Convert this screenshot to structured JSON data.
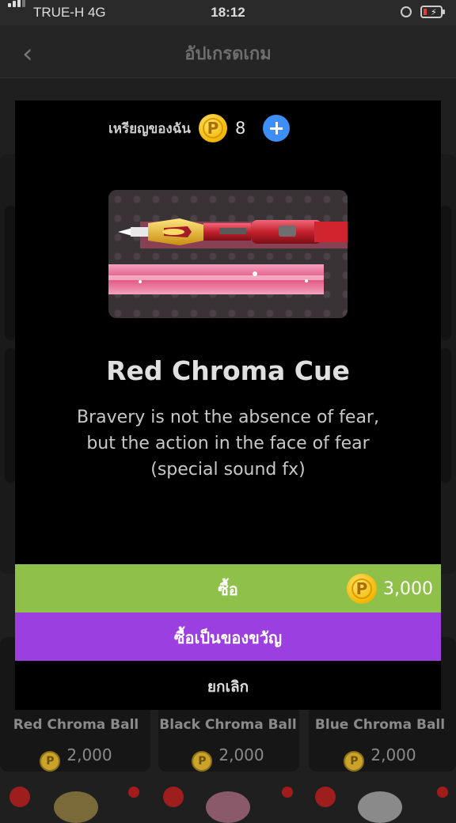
{
  "status_bar": {
    "carrier": "TRUE-H  4G",
    "time": "18:12"
  },
  "header": {
    "title": "อัปเกรดเกม",
    "back_icon": "chevron-left-icon"
  },
  "background_items": [
    {
      "name": "Red Chroma Ball",
      "price": "2,000"
    },
    {
      "name": "Black Chroma Ball",
      "price": "2,000"
    },
    {
      "name": "Blue Chroma Ball",
      "price": "2,000"
    }
  ],
  "modal": {
    "coins_label": "เหรียญของฉัน",
    "coins_count": "8",
    "coin_symbol": "P",
    "add_coins_icon": "plus-icon",
    "item_title": "Red Chroma Cue",
    "item_description": "Bravery is not the absence of fear,\nbut the action in the face of fear\n(special sound fx)",
    "buy_label": "ซื้อ",
    "buy_price": "3,000",
    "gift_label": "ซื้อเป็นของขวัญ",
    "cancel_label": "ยกเลิก"
  },
  "colors": {
    "buy_button": "#8fc14a",
    "gift_button": "#9b3fe0",
    "add_button": "#3e8ef7",
    "coin": "#f2b705"
  }
}
